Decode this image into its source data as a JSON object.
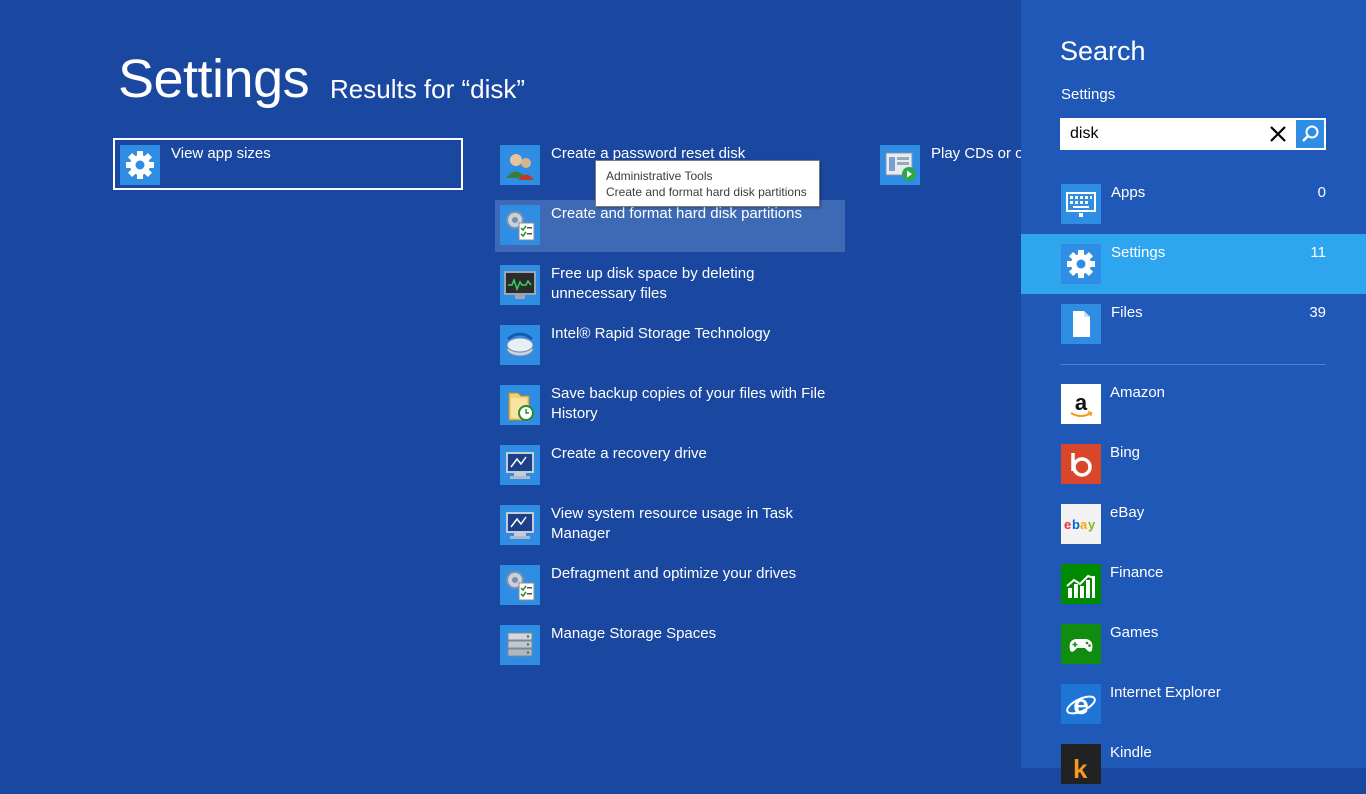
{
  "header": {
    "title": "Settings",
    "results_for": "Results for “disk”"
  },
  "results": [
    {
      "label": "View app sizes",
      "icon": "gear-icon"
    },
    {
      "label": "Create a password reset disk",
      "icon": "users-icon"
    },
    {
      "label": "Create and format hard disk partitions",
      "icon": "admin-tools-icon"
    },
    {
      "label": "Free up disk space by deleting unnecessary files",
      "icon": "monitor-graph-icon"
    },
    {
      "label": "Intel® Rapid Storage Technology",
      "icon": "intel-storage-icon"
    },
    {
      "label": "Save backup copies of your files with File History",
      "icon": "folder-clock-icon"
    },
    {
      "label": "Create a recovery drive",
      "icon": "computer-icon"
    },
    {
      "label": "View system resource usage in Task Manager",
      "icon": "computer-icon"
    },
    {
      "label": "Defragment and optimize your drives",
      "icon": "admin-tools-icon"
    },
    {
      "label": "Manage Storage Spaces",
      "icon": "drives-icon"
    },
    {
      "label": "Play CDs or ot",
      "icon": "media-play-icon"
    }
  ],
  "tooltip": {
    "title": "Administrative Tools",
    "text": "Create and format hard disk partitions"
  },
  "search_pane": {
    "title": "Search",
    "scope": "Settings",
    "query": "disk",
    "categories": [
      {
        "name": "Apps",
        "count": "0",
        "icon": "keyboard-icon"
      },
      {
        "name": "Settings",
        "count": "11",
        "icon": "gear-icon"
      },
      {
        "name": "Files",
        "count": "39",
        "icon": "file-icon"
      }
    ],
    "apps": [
      {
        "name": "Amazon",
        "icon": "amazon-icon",
        "color": "#ffffff"
      },
      {
        "name": "Bing",
        "icon": "bing-icon",
        "color": "#d9472b"
      },
      {
        "name": "eBay",
        "icon": "ebay-icon",
        "color": "#f2f2f2"
      },
      {
        "name": "Finance",
        "icon": "finance-icon",
        "color": "#008a00"
      },
      {
        "name": "Games",
        "icon": "games-icon",
        "color": "#108c10"
      },
      {
        "name": "Internet Explorer",
        "icon": "internet-explorer-icon",
        "color": "#1e75d6"
      },
      {
        "name": "Kindle",
        "icon": "kindle-icon",
        "color": "#222222"
      }
    ]
  },
  "colors": {
    "background": "#1a47a0",
    "pane": "#2058b8",
    "accent": "#2ea6ef",
    "tile": "#2980e3"
  }
}
